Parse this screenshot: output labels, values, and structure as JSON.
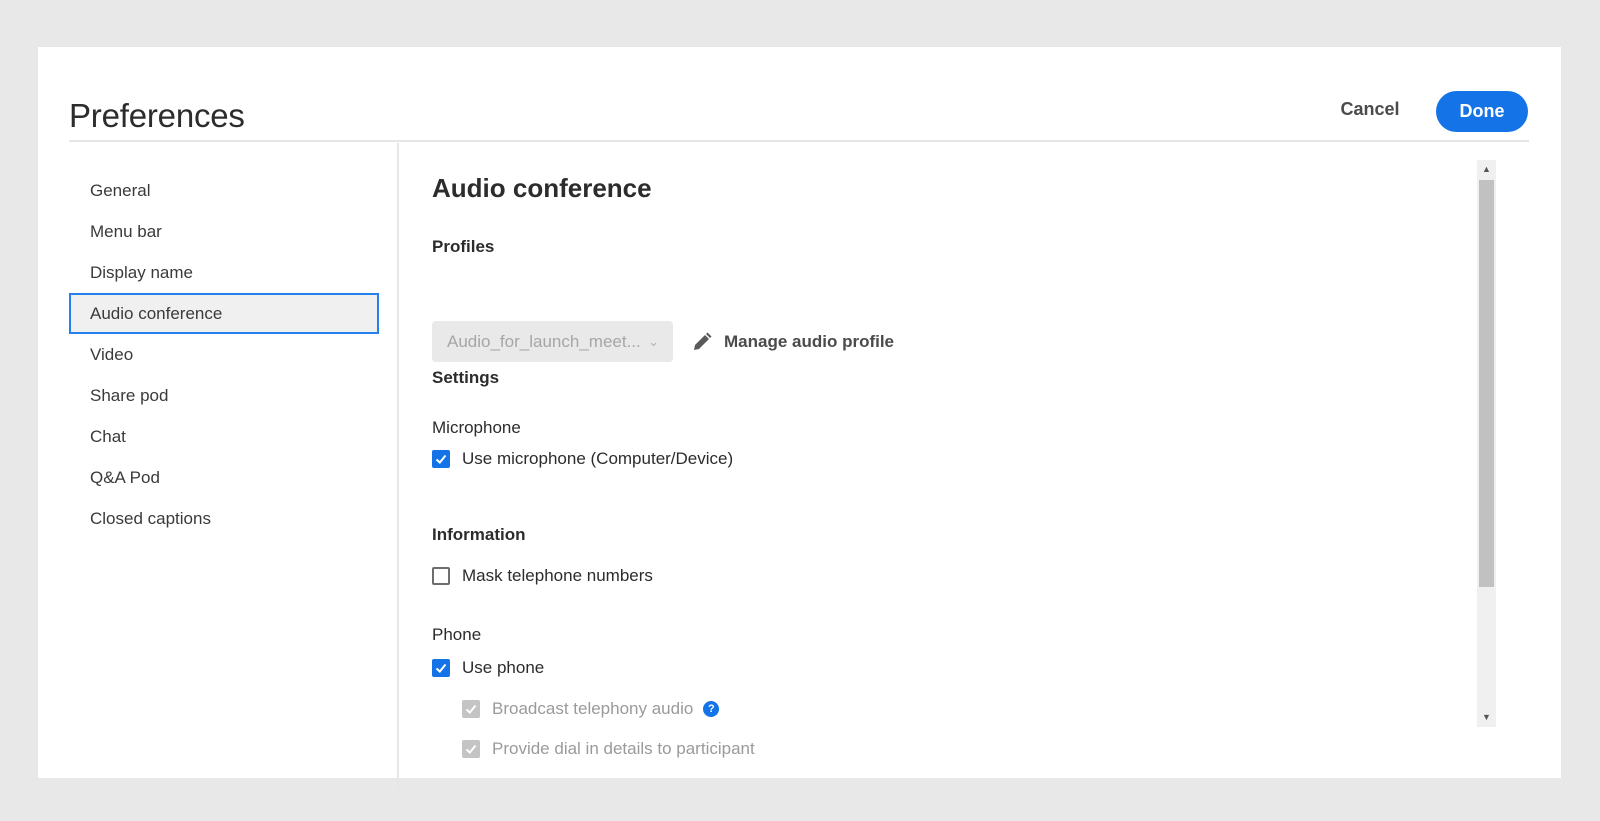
{
  "dialog": {
    "title": "Preferences",
    "cancel_label": "Cancel",
    "done_label": "Done"
  },
  "sidebar": {
    "items": [
      {
        "label": "General"
      },
      {
        "label": "Menu bar"
      },
      {
        "label": "Display name"
      },
      {
        "label": "Audio conference",
        "selected": true
      },
      {
        "label": "Video"
      },
      {
        "label": "Share pod"
      },
      {
        "label": "Chat"
      },
      {
        "label": "Q&A Pod"
      },
      {
        "label": "Closed captions"
      }
    ]
  },
  "content": {
    "title": "Audio conference",
    "profiles_label": "Profiles",
    "profile_select_value": "Audio_for_launch_meet...",
    "manage_profile_label": "Manage audio profile",
    "settings_label": "Settings",
    "microphone_label": "Microphone",
    "use_microphone_label": "Use microphone (Computer/Device)",
    "use_microphone_checked": true,
    "information_label": "Information",
    "mask_numbers_label": "Mask telephone numbers",
    "mask_numbers_checked": false,
    "phone_label": "Phone",
    "use_phone_label": "Use phone",
    "use_phone_checked": true,
    "broadcast_label": "Broadcast telephony audio",
    "broadcast_checked": true,
    "dial_in_label": "Provide dial in details to participant",
    "dial_in_checked": true
  },
  "icons": {
    "pencil": "pencil-icon",
    "checkmark": "checkmark-icon",
    "help": "help-icon",
    "chevron": "chevron-down-icon"
  },
  "colors": {
    "accent": "#1473e6",
    "selected_border": "#2680eb",
    "disabled": "#c4c4c4"
  }
}
